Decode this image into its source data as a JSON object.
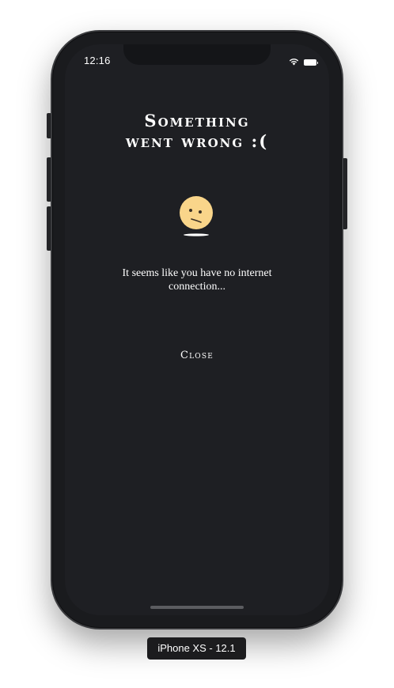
{
  "status_bar": {
    "time": "12:16",
    "wifi_icon": "wifi-icon",
    "battery_icon": "battery-icon"
  },
  "error": {
    "title_line1": "Something",
    "title_line2": "went wrong :(",
    "emoji_icon": "confused-face-icon",
    "message": "It seems like you have no internet connection...",
    "close_label": "Close"
  },
  "simulator": {
    "device_label": "iPhone XS - 12.1"
  },
  "colors": {
    "screen_background": "#1e1f23",
    "text": "#ffffff",
    "emoji": "#f9d58a"
  }
}
